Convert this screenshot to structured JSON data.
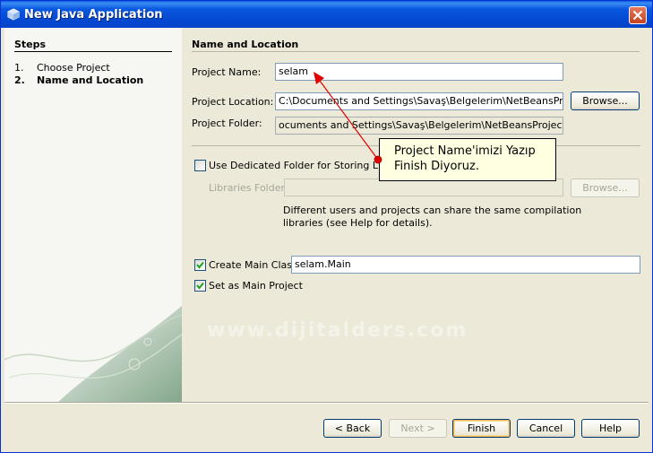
{
  "window": {
    "title": "New Java Application"
  },
  "steps": {
    "title": "Steps",
    "items": [
      {
        "num": "1.",
        "label": "Choose Project"
      },
      {
        "num": "2.",
        "label": "Name and Location"
      }
    ]
  },
  "section": {
    "title": "Name and Location"
  },
  "project_name": {
    "label": "Project Name:",
    "value": "selam"
  },
  "project_location": {
    "label": "Project Location:",
    "value": "C:\\Documents and Settings\\Savaş\\Belgelerim\\NetBeansProjects",
    "browse": "Browse..."
  },
  "project_folder": {
    "label": "Project Folder:",
    "value": "ocuments and Settings\\Savaş\\Belgelerim\\NetBeansProjects\\selam"
  },
  "libraries": {
    "checkbox_label": "Use Dedicated Folder for Storing Librari",
    "checked": false,
    "folder_label": "Libraries Folder:",
    "folder_value": "",
    "browse": "Browse...",
    "help_line1": "Different users and projects can share the same compilation",
    "help_line2": "libraries (see Help for details)."
  },
  "main_class": {
    "label": "Create Main Class",
    "checked": true,
    "value": "selam.Main"
  },
  "main_project": {
    "label": "Set as Main Project",
    "checked": true
  },
  "tooltip": {
    "line1": "Project Name'imizi Yazıp",
    "line2": "Finish Diyoruz."
  },
  "watermark": "www.dijitalders.com",
  "buttons": {
    "back": "< Back",
    "next": "Next >",
    "finish": "Finish",
    "cancel": "Cancel",
    "help": "Help"
  },
  "colors": {
    "titlebar": "#0a58e0",
    "arrow": "#e00000",
    "tooltip_bg": "#ffffe1",
    "dialog_bg": "#ece9d8"
  }
}
